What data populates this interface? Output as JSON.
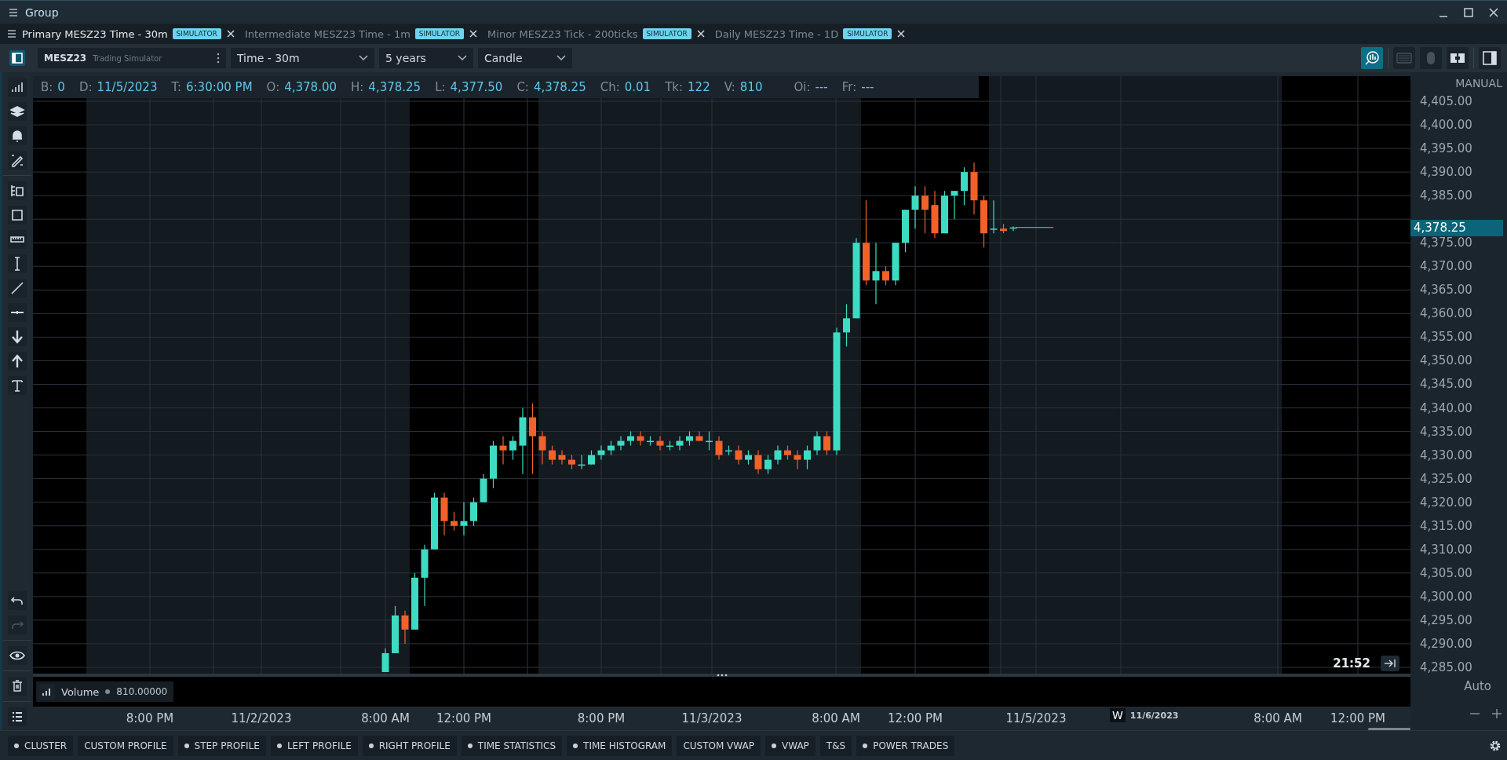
{
  "window": {
    "title": "Group"
  },
  "tabs": [
    {
      "label": "Primary MESZ23 Time - 30m",
      "badge": "SIMULATOR",
      "selected": true
    },
    {
      "label": "Intermediate MESZ23 Time - 1m",
      "badge": "SIMULATOR",
      "selected": false
    },
    {
      "label": "Minor MESZ23 Tick - 200ticks",
      "badge": "SIMULATOR",
      "selected": false
    },
    {
      "label": "Daily MESZ23 Time - 1D",
      "badge": "SIMULATOR",
      "selected": false
    }
  ],
  "toolbar": {
    "symbol": "MESZ23",
    "account": "Trading Simulator",
    "timeframe": "Time - 30m",
    "range": "5 years",
    "chart_type": "Candle",
    "tools": [
      {
        "kind": "search",
        "active": true,
        "disabled": false
      },
      {
        "kind": "keyboard",
        "active": false,
        "disabled": true
      },
      {
        "kind": "mouse",
        "active": false,
        "disabled": true
      },
      {
        "kind": "layout",
        "active": false,
        "disabled": false
      },
      {
        "kind": "panel",
        "active": false,
        "disabled": false
      }
    ]
  },
  "history": {
    "undo_disabled": false,
    "redo_disabled": true
  },
  "info_bar": [
    {
      "label": "B:",
      "value": "0"
    },
    {
      "label": "D:",
      "value": "11/5/2023"
    },
    {
      "label": "T:",
      "value": "6:30:00 PM"
    },
    {
      "label": "O:",
      "value": "4,378.00"
    },
    {
      "label": "H:",
      "value": "4,378.25"
    },
    {
      "label": "L:",
      "value": "4,377.50"
    },
    {
      "label": "C:",
      "value": "4,378.25"
    },
    {
      "label": "Ch:",
      "value": "0.01"
    },
    {
      "label": "Tk:",
      "value": "122"
    },
    {
      "label": "V:",
      "value": "810"
    },
    {
      "label": "Oi:",
      "value": "---"
    },
    {
      "label": "Fr:",
      "value": "---"
    }
  ],
  "price_axis": {
    "mode": "MANUAL",
    "labels": [
      "4,405.00",
      "4,400.00",
      "4,395.00",
      "4,390.00",
      "4,385.00",
      "4,375.00",
      "4,370.00",
      "4,365.00",
      "4,360.00",
      "4,355.00",
      "4,350.00",
      "4,345.00",
      "4,340.00",
      "4,335.00",
      "4,330.00",
      "4,325.00",
      "4,320.00",
      "4,315.00",
      "4,310.00",
      "4,305.00",
      "4,300.00",
      "4,295.00",
      "4,290.00",
      "4,285.00"
    ],
    "current_price": "4,378.25",
    "scale": "Auto"
  },
  "chart": {
    "countdown": "21:52"
  },
  "volume_pane": {
    "title": "Volume",
    "value": "810.00000"
  },
  "time_axis": {
    "labels": [
      "8:00 PM",
      "11/2/2023",
      "8:00 AM",
      "12:00 PM",
      "8:00 PM",
      "11/3/2023",
      "8:00 AM",
      "12:00 PM",
      "11/5/2023",
      "8:00 AM",
      "12:00 PM"
    ],
    "week_marker": {
      "badge": "W",
      "date": "11/6/2023"
    }
  },
  "bottom_tabs": [
    {
      "label": "CLUSTER",
      "dot": true
    },
    {
      "label": "CUSTOM PROFILE",
      "dot": false
    },
    {
      "label": "STEP PROFILE",
      "dot": true
    },
    {
      "label": "LEFT PROFILE",
      "dot": true
    },
    {
      "label": "RIGHT PROFILE",
      "dot": true
    },
    {
      "label": "TIME STATISTICS",
      "dot": true
    },
    {
      "label": "TIME HISTOGRAM",
      "dot": true
    },
    {
      "label": "CUSTOM VWAP",
      "dot": false
    },
    {
      "label": "VWAP",
      "dot": true
    },
    {
      "label": "T&S",
      "dot": false
    },
    {
      "label": "POWER TRADES",
      "dot": true
    }
  ]
}
